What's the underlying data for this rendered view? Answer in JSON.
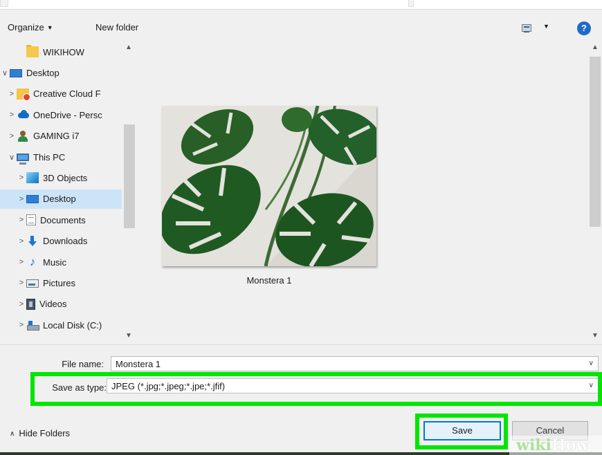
{
  "toolbar": {
    "organize_label": "Organize",
    "new_folder_label": "New folder",
    "view_icon": "view-options-icon",
    "help_label": "?"
  },
  "nav": {
    "items": [
      {
        "label": "WIKIHOW",
        "icon": "folder-icon",
        "level": 2,
        "expander": ""
      },
      {
        "label": "Desktop",
        "icon": "desktop-icon",
        "level": 0,
        "expander": "expanded"
      },
      {
        "label": "Creative Cloud F",
        "icon": "creative-cloud-icon",
        "level": 1,
        "expander": "collapsed"
      },
      {
        "label": "OneDrive - Persc",
        "icon": "onedrive-icon",
        "level": 1,
        "expander": "collapsed"
      },
      {
        "label": "GAMING i7",
        "icon": "user-icon",
        "level": 1,
        "expander": "collapsed"
      },
      {
        "label": "This PC",
        "icon": "this-pc-icon",
        "level": 1,
        "expander": "expanded"
      },
      {
        "label": "3D Objects",
        "icon": "3d-objects-icon",
        "level": 2,
        "expander": "collapsed"
      },
      {
        "label": "Desktop",
        "icon": "desktop-icon",
        "level": 2,
        "expander": "collapsed",
        "selected": true
      },
      {
        "label": "Documents",
        "icon": "documents-icon",
        "level": 2,
        "expander": "collapsed"
      },
      {
        "label": "Downloads",
        "icon": "downloads-icon",
        "level": 2,
        "expander": "collapsed"
      },
      {
        "label": "Music",
        "icon": "music-icon",
        "level": 2,
        "expander": "collapsed"
      },
      {
        "label": "Pictures",
        "icon": "pictures-icon",
        "level": 2,
        "expander": "collapsed"
      },
      {
        "label": "Videos",
        "icon": "videos-icon",
        "level": 2,
        "expander": "collapsed"
      },
      {
        "label": "Local Disk (C:)",
        "icon": "local-disk-icon",
        "level": 2,
        "expander": "collapsed"
      }
    ]
  },
  "content": {
    "file": {
      "name": "Monstera 1",
      "thumbnail": "monstera-photo"
    }
  },
  "form": {
    "file_name_label": "File name:",
    "file_name_value": "Monstera 1",
    "save_type_label": "Save as type:",
    "save_type_value": "JPEG (*.jpg;*.jpeg;*.jpe;*.jfif)"
  },
  "footer": {
    "hide_folders_label": "Hide Folders",
    "save_label": "Save",
    "cancel_label": "Cancel"
  },
  "watermark": {
    "part1": "wiki",
    "part2": "How"
  },
  "colors": {
    "highlight": "#00e600",
    "accent": "#0078d7",
    "selection": "#cce4f7"
  }
}
